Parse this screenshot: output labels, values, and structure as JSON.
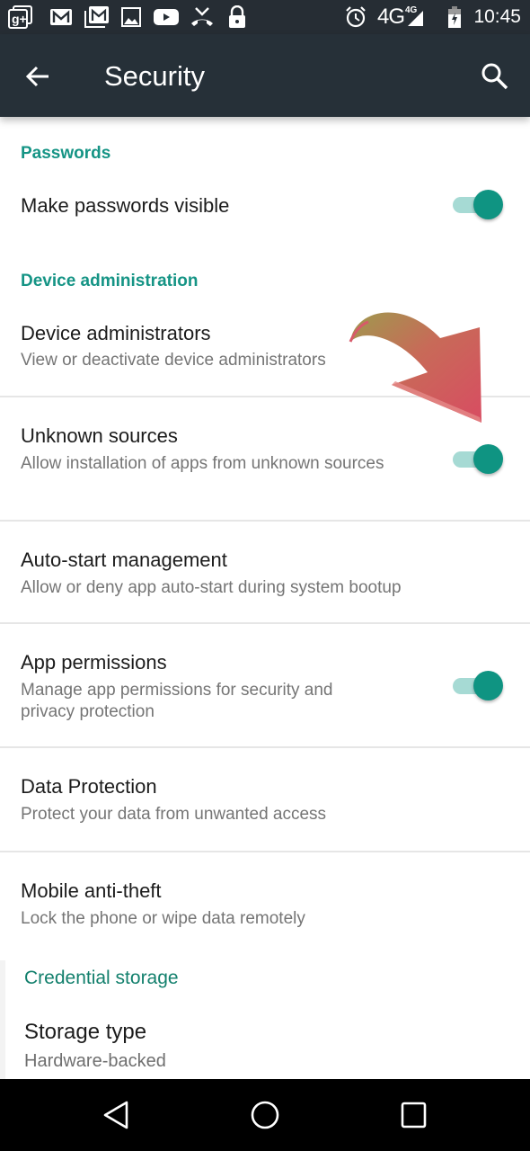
{
  "status_bar": {
    "left_icons": [
      "google-plus-icon",
      "gmail-icon",
      "gmail-stack-icon",
      "gallery-icon",
      "youtube-icon",
      "missed-call-icon",
      "lock-icon"
    ],
    "right_icons": [
      "alarm-icon",
      "signal-icon",
      "battery-charging-icon"
    ],
    "network": "4G",
    "network_small": "4G",
    "time": "10:45"
  },
  "app_bar": {
    "title": "Security",
    "back_icon": "arrow-back-icon",
    "search_icon": "search-icon"
  },
  "colors": {
    "accent": "#159485",
    "app_bar": "#263038",
    "status_bar": "#262d34",
    "switch_thumb": "#0f9482",
    "switch_track": "#a6dad4"
  },
  "sections": {
    "passwords": {
      "header": "Passwords",
      "items": [
        {
          "title": "Make passwords visible",
          "switch_on": true
        }
      ]
    },
    "device_administration": {
      "header": "Device administration",
      "items": [
        {
          "title": "Device administrators",
          "summary": "View or deactivate device administrators"
        },
        {
          "title": "Unknown sources",
          "summary": "Allow installation of apps from unknown sources",
          "switch_on": true
        },
        {
          "title": "Auto-start management",
          "summary": "Allow or deny app auto-start during system bootup"
        },
        {
          "title": "App permissions",
          "summary": "Manage app permissions for security and privacy protection",
          "switch_on": true
        },
        {
          "title": "Data Protection",
          "summary": "Protect your data from unwanted access"
        },
        {
          "title": "Mobile anti-theft",
          "summary": "Lock the phone or wipe data remotely"
        }
      ]
    },
    "credential_storage": {
      "header": "Credential storage",
      "items": [
        {
          "title": "Storage type",
          "summary": "Hardware-backed"
        }
      ]
    }
  },
  "annotation": {
    "type": "arrow",
    "points_to": "Unknown sources"
  },
  "nav_bar": {
    "buttons": [
      "back-icon",
      "home-icon",
      "recents-icon"
    ]
  }
}
